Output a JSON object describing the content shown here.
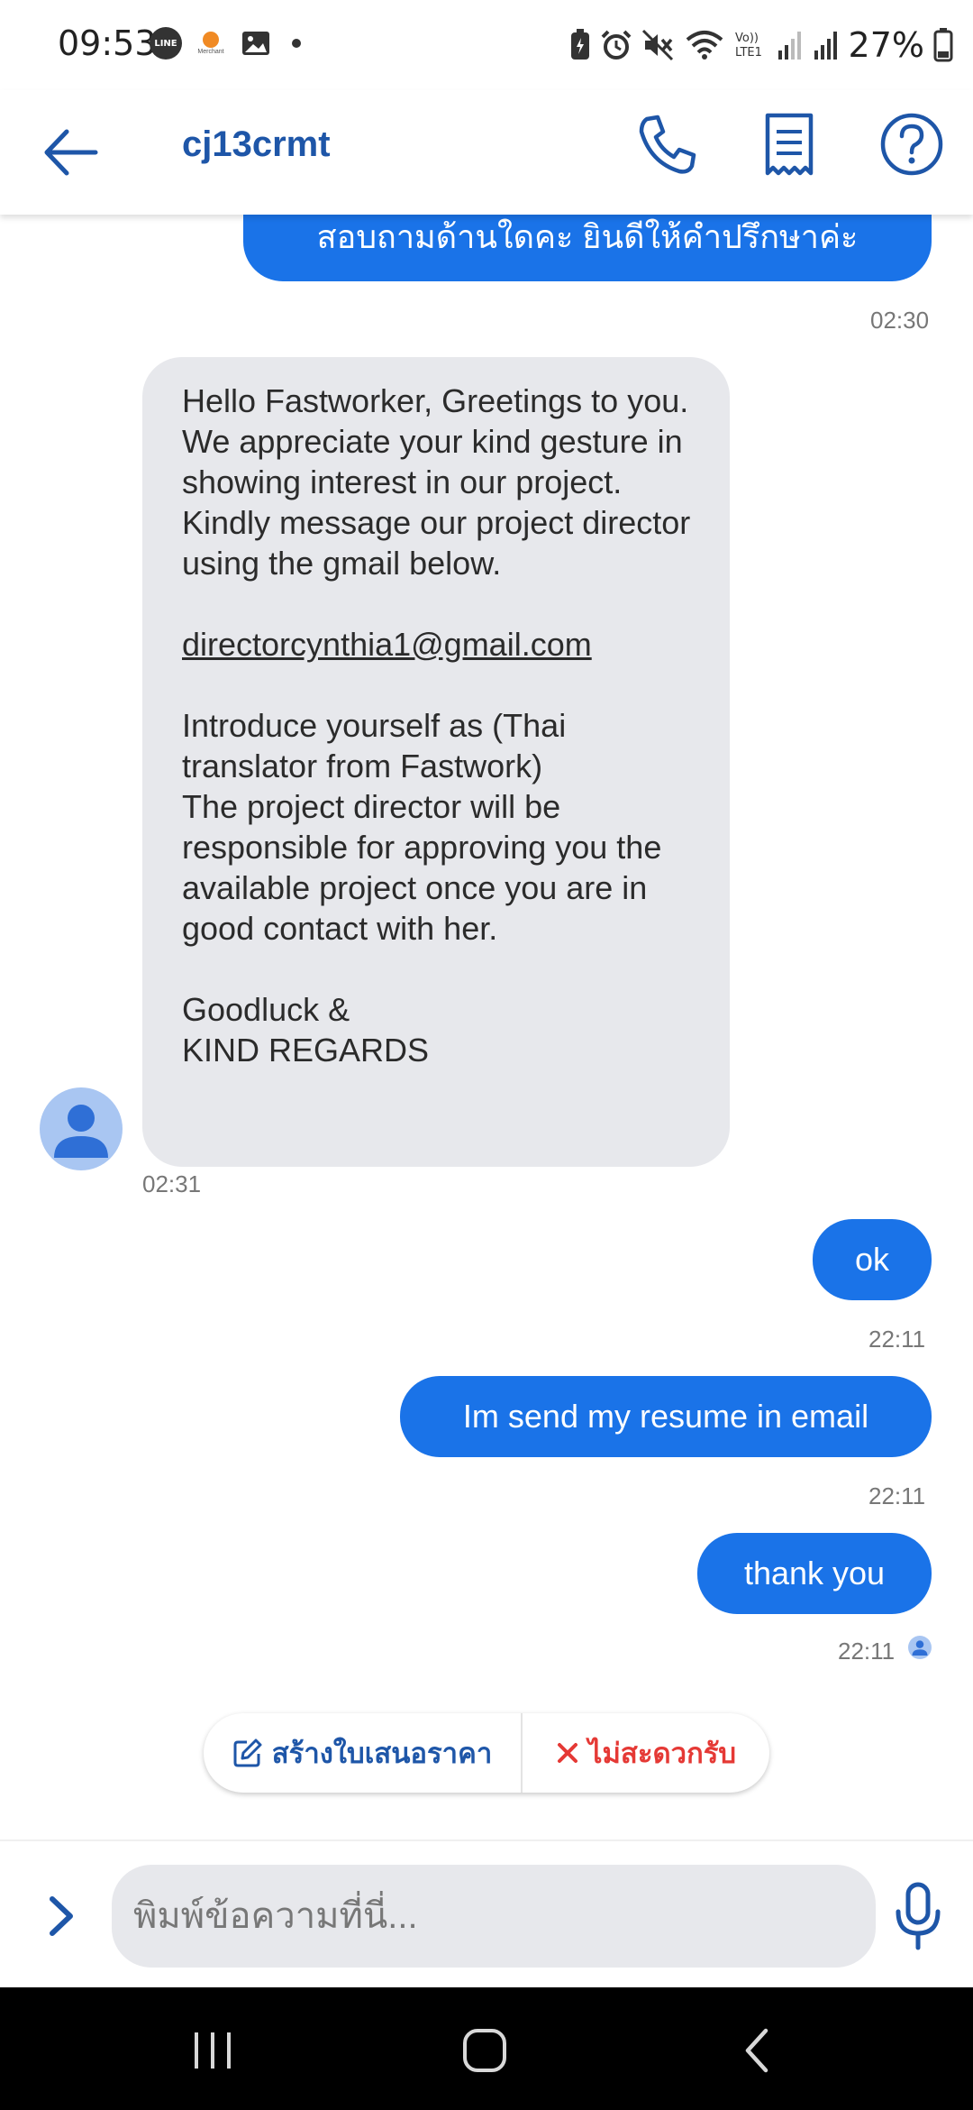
{
  "status_bar": {
    "time": "09:53",
    "line_label": "LINE",
    "app_label": "Merchant",
    "battery_percent": "27%",
    "network_label": "Vo)) LTE1"
  },
  "header": {
    "chat_title": "cj13crmt",
    "accent_color": "#1e56a8"
  },
  "messages": {
    "first_outgoing": "สอบถามด้านใดคะ ยินดีให้คำปรึกษาค่ะ",
    "first_outgoing_time": "02:30",
    "incoming": {
      "lines": [
        "Hello Fastworker, Greetings to you.",
        "We appreciate your kind gesture in showing interest in our project.",
        "Kindly message our project director using the gmail below."
      ],
      "email": "directorcynthia1@gmail.com",
      "lines2": [
        "Introduce yourself as (Thai translator from Fastwork)",
        "The project director will be responsible for approving you the available project once you are in good contact with her."
      ],
      "closing1": "Goodluck &",
      "closing2": "KIND REGARDS",
      "time": "02:31"
    },
    "reply_ok": "ok",
    "reply_ok_time": "22:11",
    "reply_resume": "Im send my resume in email",
    "reply_resume_time": "22:11",
    "reply_thanks": "thank you",
    "reply_thanks_time": "22:11"
  },
  "actions": {
    "create_quote_label": "สร้างใบเสนอราคา",
    "decline_label": "ไม่สะดวกรับ"
  },
  "input": {
    "placeholder": "พิมพ์ข้อความที่นี่..."
  },
  "colors": {
    "outgoing_bubble": "#1a73e8",
    "incoming_bubble": "#e7e8ec",
    "decline_red": "#e53935"
  }
}
